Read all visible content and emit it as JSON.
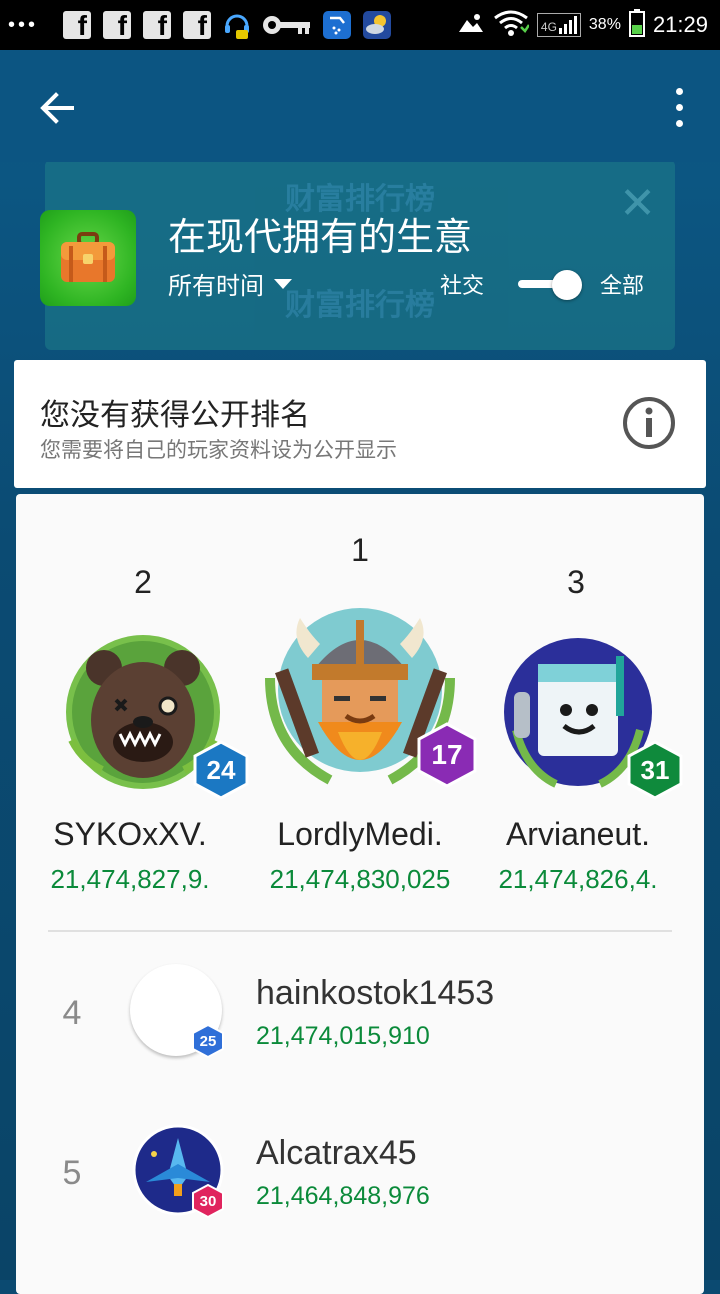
{
  "status_bar": {
    "network": "4G",
    "battery": "38%",
    "time": "21:29"
  },
  "background": {
    "title_top": "财富排行榜",
    "title_bottom": "财富排行榜"
  },
  "header": {
    "title": "在现代拥有的生意",
    "timespan": "所有时间",
    "social_label": "社交",
    "all_label": "全部"
  },
  "notice": {
    "title": "您没有获得公开排名",
    "subtitle": "您需要将自己的玩家资料设为公开显示"
  },
  "colors": {
    "appbar": "#0c5582",
    "score_green": "#0b8a3a",
    "badge_blue": "#1b78c3",
    "badge_purple": "#8a2bb4",
    "badge_green": "#0f8a3c",
    "badge_small_blue": "#2f6fd8",
    "badge_small_pink": "#e0245e"
  },
  "podium": [
    {
      "rank": "2",
      "name": "SYKOxXV.",
      "score": "21,474,827,9.",
      "level": "24",
      "avatar_icon": "bear-avatar-icon"
    },
    {
      "rank": "1",
      "name": "LordlyMedi.",
      "score": "21,474,830,025",
      "level": "17",
      "avatar_icon": "viking-avatar-icon"
    },
    {
      "rank": "3",
      "name": "Arvianeut.",
      "score": "21,474,826,4.",
      "level": "31",
      "avatar_icon": "robot-avatar-icon"
    }
  ],
  "list": [
    {
      "rank": "4",
      "name": "hainkostok1453",
      "score": "21,474,015,910",
      "level": "25",
      "avatar_icon": "blank-avatar-icon"
    },
    {
      "rank": "5",
      "name": "Alcatrax45",
      "score": "21,464,848,976",
      "level": "30",
      "avatar_icon": "spaceship-avatar-icon"
    }
  ]
}
